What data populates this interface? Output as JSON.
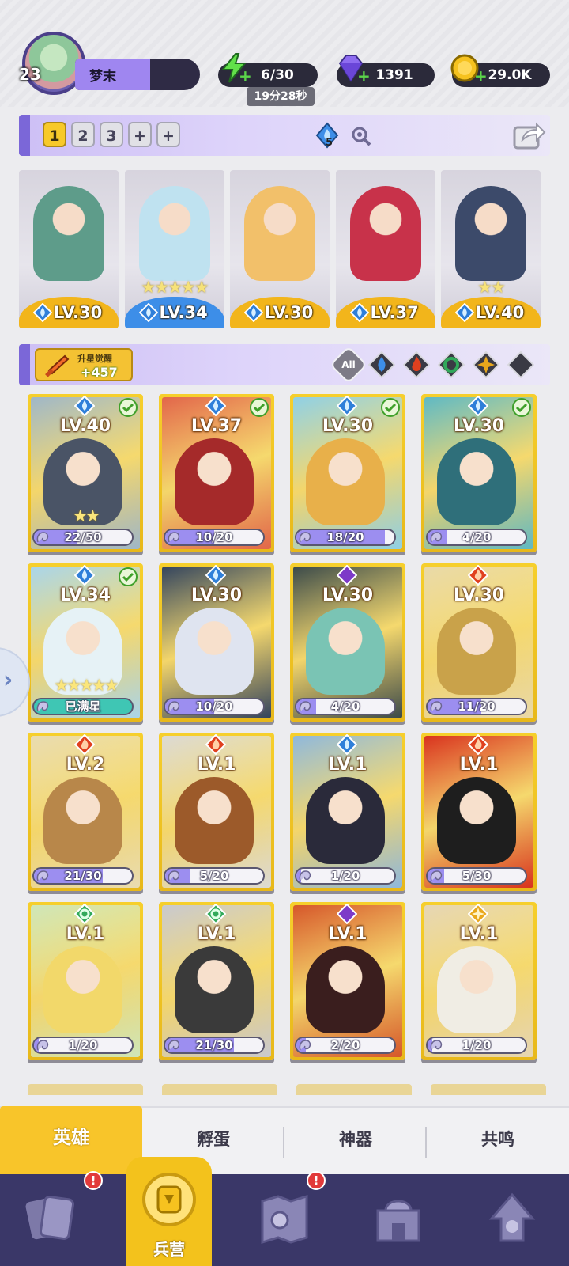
{
  "player": {
    "name": "梦末",
    "level": "23"
  },
  "resources": {
    "energy": {
      "value": "6/30",
      "timer": "19分28秒",
      "icon": "lightning-icon"
    },
    "gems": {
      "value": "1391",
      "icon": "gem-icon"
    },
    "gold": {
      "value": "29.0K",
      "icon": "coin-icon"
    }
  },
  "team": {
    "slots": [
      "1",
      "2",
      "3",
      "+",
      "+"
    ],
    "active_slot": "1",
    "gem_badge": "5",
    "lineup": [
      {
        "level": "LV.30",
        "stars": "",
        "element": "water",
        "art": "eagle-hero"
      },
      {
        "level": "LV.34",
        "stars": "★★★★★",
        "element": "water",
        "art": "snow-hero"
      },
      {
        "level": "LV.30",
        "stars": "",
        "element": "water",
        "art": "corgi-hero"
      },
      {
        "level": "LV.37",
        "stars": "",
        "element": "water",
        "art": "red-hair-hero"
      },
      {
        "level": "LV.40",
        "stars": "★★",
        "element": "water",
        "art": "scythe-hero"
      }
    ]
  },
  "filter": {
    "awaken_label": "升星觉醒",
    "awaken_value": "+457",
    "all_label": "All",
    "elements": [
      "water",
      "fire",
      "wind",
      "light",
      "dark"
    ]
  },
  "colors": {
    "water": "#2f7fd9",
    "fire": "#e0401f",
    "wind": "#31a95a",
    "light": "#e9a81c",
    "dark": "#7d3ac8",
    "gold_card": "#f2c529",
    "accent_purple": "#9c8ef0"
  },
  "heroes": [
    {
      "level": "LV.40",
      "element": "water",
      "progress": "22/50",
      "progress_value": 0.44,
      "stars": "★★",
      "checked": true,
      "bg": "#9fb7c8",
      "fig": "#4a5466"
    },
    {
      "level": "LV.37",
      "element": "water",
      "progress": "10/20",
      "progress_value": 0.5,
      "stars": "",
      "checked": true,
      "bg": "#e2664a",
      "fig": "#a52a2a"
    },
    {
      "level": "LV.30",
      "element": "water",
      "progress": "18/20",
      "progress_value": 0.9,
      "stars": "",
      "checked": true,
      "bg": "#8fd0e6",
      "fig": "#e8b04a"
    },
    {
      "level": "LV.30",
      "element": "water",
      "progress": "4/20",
      "progress_value": 0.2,
      "stars": "",
      "checked": true,
      "bg": "#5fb9c4",
      "fig": "#2f6f7a"
    },
    {
      "level": "LV.34",
      "element": "water",
      "progress": "已满星",
      "progress_value": 1,
      "stars": "★★★★★",
      "checked": true,
      "bg": "#a9d5ea",
      "fig": "#e6f2f6",
      "full": true
    },
    {
      "level": "LV.30",
      "element": "water",
      "progress": "10/20",
      "progress_value": 0.5,
      "stars": "",
      "checked": false,
      "bg": "#33445e",
      "fig": "#dfe4f0"
    },
    {
      "level": "LV.30",
      "element": "dark",
      "progress": "4/20",
      "progress_value": 0.2,
      "stars": "",
      "checked": false,
      "bg": "#3b4a4a",
      "fig": "#7ac4b4"
    },
    {
      "level": "LV.30",
      "element": "fire",
      "progress": "11/20",
      "progress_value": 0.55,
      "stars": "",
      "checked": false,
      "bg": "#e9d9a8",
      "fig": "#c9a24a"
    },
    {
      "level": "LV.2",
      "element": "fire",
      "progress": "21/30",
      "progress_value": 0.7,
      "stars": "",
      "checked": false,
      "bg": "#e9dcb0",
      "fig": "#b8874a"
    },
    {
      "level": "LV.1",
      "element": "fire",
      "progress": "5/20",
      "progress_value": 0.25,
      "stars": "",
      "checked": false,
      "bg": "#dcdad4",
      "fig": "#9c5a2a"
    },
    {
      "level": "LV.1",
      "element": "water",
      "progress": "1/20",
      "progress_value": 0.05,
      "stars": "",
      "checked": false,
      "bg": "#8fb8dc",
      "fig": "#2a2a3a"
    },
    {
      "level": "LV.1",
      "element": "fire",
      "progress": "5/30",
      "progress_value": 0.17,
      "stars": "",
      "checked": false,
      "bg": "#d9331e",
      "fig": "#1e1e1e"
    },
    {
      "level": "LV.1",
      "element": "wind",
      "progress": "1/20",
      "progress_value": 0.05,
      "stars": "",
      "checked": false,
      "bg": "#cfe6b8",
      "fig": "#f2d86a"
    },
    {
      "level": "LV.1",
      "element": "wind",
      "progress": "21/30",
      "progress_value": 0.7,
      "stars": "",
      "checked": false,
      "bg": "#c9c9cf",
      "fig": "#3a3a3a"
    },
    {
      "level": "LV.1",
      "element": "dark",
      "progress": "2/20",
      "progress_value": 0.1,
      "stars": "",
      "checked": false,
      "bg": "#d6572a",
      "fig": "#3a1e1e"
    },
    {
      "level": "LV.1",
      "element": "light",
      "progress": "1/20",
      "progress_value": 0.05,
      "stars": "",
      "checked": false,
      "bg": "#e6d6b4",
      "fig": "#f0ede4"
    }
  ],
  "sub_tabs": [
    "英雄",
    "孵蛋",
    "神器",
    "共鸣"
  ],
  "bottom_nav": [
    {
      "name": "cards",
      "label": "",
      "badge": "!"
    },
    {
      "name": "barracks",
      "label": "兵营",
      "badge": ""
    },
    {
      "name": "map",
      "label": "",
      "badge": "!"
    },
    {
      "name": "castle",
      "label": "",
      "badge": ""
    },
    {
      "name": "shrine",
      "label": "",
      "badge": ""
    }
  ]
}
